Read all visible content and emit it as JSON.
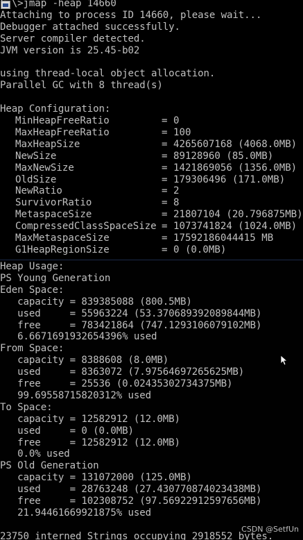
{
  "top": {
    "lines": [
      "C:\\>jmap -heap 14660",
      "Attaching to process ID 14660, please wait...",
      "Debugger attached successfully.",
      "Server compiler detected.",
      "JVM version is 25.45-b02",
      "",
      "using thread-local object allocation.",
      "Parallel GC with 8 thread(s)",
      "",
      "Heap Configuration:"
    ],
    "config": [
      {
        "name": "MinHeapFreeRatio",
        "value": "= 0"
      },
      {
        "name": "MaxHeapFreeRatio",
        "value": "= 100"
      },
      {
        "name": "MaxHeapSize",
        "value": "= 4265607168 (4068.0MB)"
      },
      {
        "name": "NewSize",
        "value": "= 89128960 (85.0MB)"
      },
      {
        "name": "MaxNewSize",
        "value": "= 1421869056 (1356.0MB)"
      },
      {
        "name": "OldSize",
        "value": "= 179306496 (171.0MB)"
      },
      {
        "name": "NewRatio",
        "value": "= 2"
      },
      {
        "name": "SurvivorRatio",
        "value": "= 8"
      },
      {
        "name": "MetaspaceSize",
        "value": "= 21807104 (20.796875MB)"
      },
      {
        "name": "CompressedClassSpaceSize",
        "value": "= 1073741824 (1024.0MB)"
      },
      {
        "name": "MaxMetaspaceSize",
        "value": "= 17592186044415 MB"
      },
      {
        "name": "G1HeapRegionSize",
        "value": "= 0 (0.0MB)"
      }
    ]
  },
  "bottom": {
    "lines": [
      "Heap Usage:",
      "PS Young Generation",
      "Eden Space:",
      "   capacity = 839385088 (800.5MB)",
      "   used     = 55963224 (53.370689392089844MB)",
      "   free     = 783421864 (747.1293106079102MB)",
      "   6.667169193265439​6% used",
      "From Space:",
      "   capacity = 8388608 (8.0MB)",
      "   used     = 8363072 (7.97564697265625MB)",
      "   free     = 25536 (0.02435302734375MB)",
      "   99.69558715820312% used",
      "To Space:",
      "   capacity = 12582912 (12.0MB)",
      "   used     = 0 (0.0MB)",
      "   free     = 12582912 (12.0MB)",
      "   0.0% used",
      "PS Old Generation",
      "   capacity = 131072000 (125.0MB)",
      "   used     = 28763248 (27.430770874023438MB)",
      "   free     = 102308752 (97.56922912597656MB)",
      "   21.94461669921875% used",
      "",
      "23750 interned Strings occupying 2918552 bytes."
    ]
  },
  "watermark": "CSDN @SetfUn",
  "icons": {
    "window": "cmd-window-icon",
    "pointer": "mouse-pointer-icon"
  }
}
